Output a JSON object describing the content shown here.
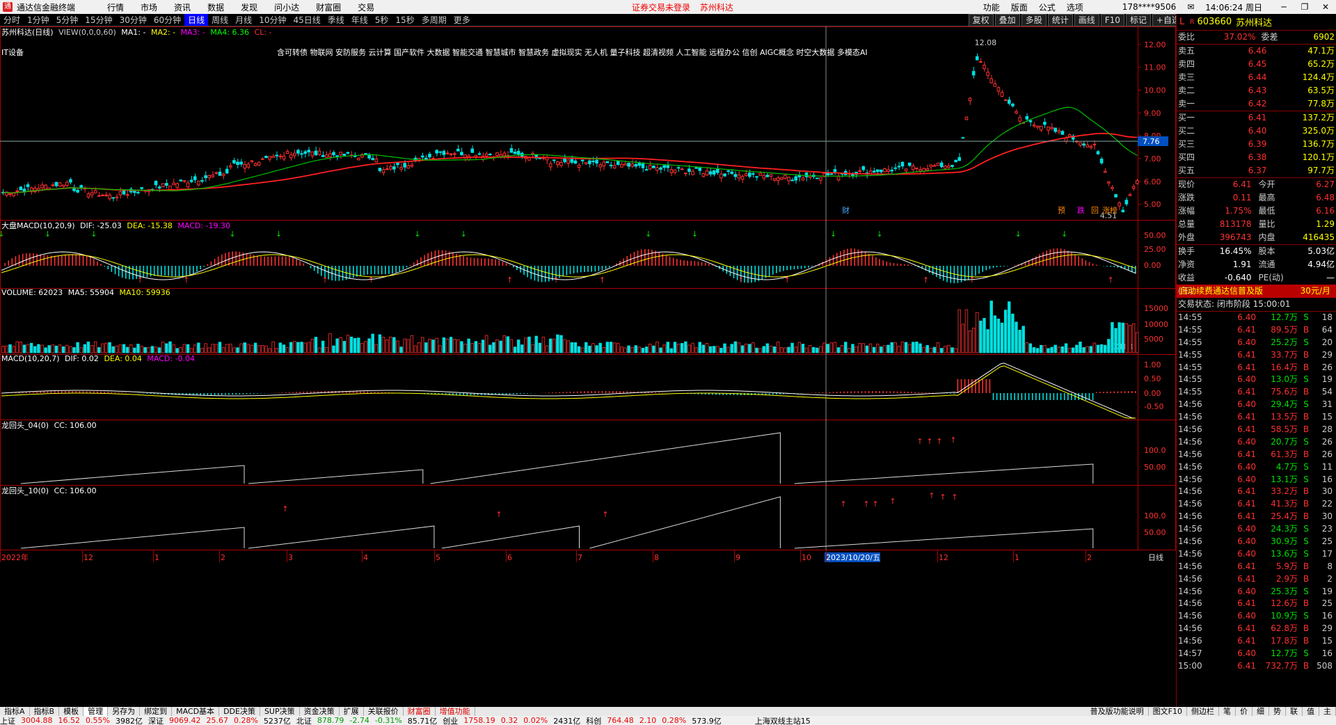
{
  "app": {
    "title": "通达信金融终端",
    "menus": [
      "行情",
      "市场",
      "资讯",
      "数据",
      "发现",
      "问小达",
      "财富圈",
      "交易"
    ],
    "center_notice": "证券交易未登录",
    "center_stock": "苏州科达",
    "right_items": [
      "功能",
      "版面",
      "公式",
      "选项"
    ],
    "account": "178****9506",
    "clock": "14:06:24 周日"
  },
  "periods": [
    "分时",
    "1分钟",
    "5分钟",
    "15分钟",
    "30分钟",
    "60分钟",
    "日线",
    "周线",
    "月线",
    "10分钟",
    "45日线",
    "季线",
    "年线",
    "5秒",
    "15秒",
    "多周期",
    "更多"
  ],
  "active_period": "日线",
  "chart_tools": [
    "复权",
    "叠加",
    "多股",
    "统计",
    "画线",
    "F10",
    "标记",
    "+自选",
    "返回"
  ],
  "main_panel": {
    "title": "苏州科达(日线)",
    "view": "VIEW(0,0,0,60)",
    "ma1": "MA1: -",
    "ma2": "MA2: -",
    "ma3": "MA3: -",
    "ma4": "MA4: 6.36",
    "cl": "CL: -",
    "sector": "IT设备",
    "concepts": "含可转债 物联网 安防服务 云计算 国产软件 大数据 智能交通 智慧城市 智慧政务 虚拟现实 无人机 量子科技 超清视频 人工智能 远程办公 信创 AIGC概念 时空大数据 多模态AI",
    "high_label": "12.08",
    "low_label": "4.51",
    "price_line_label": "7.76",
    "axis_ticks": [
      "12.00",
      "11.00",
      "10.00",
      "9.00",
      "8.00",
      "7.00",
      "6.00",
      "5.00"
    ],
    "marker_cai": "财",
    "marker_yu": "预",
    "marker_die": "跌",
    "marker_huiji": "回",
    "marker_zhang": "涨榜"
  },
  "macd_market": {
    "title": "大盘MACD(10,20,9)",
    "dif": "DIF: -25.03",
    "dea": "DEA: -15.38",
    "macd": "MACD: -19.30",
    "axis_ticks": [
      "50.00",
      "25.00",
      "0.00"
    ]
  },
  "volume": {
    "title": "VOLUME: 62023",
    "ma5": "MA5: 55904",
    "ma10": "MA10: 59936",
    "axis_ticks": [
      "15000",
      "10000",
      "5000"
    ],
    "unit": "X100"
  },
  "macd": {
    "title": "MACD(10,20,7)",
    "dif": "DIF: 0.02",
    "dea": "DEA: 0.04",
    "macd": "MACD: -0.04",
    "axis_ticks": [
      "1.00",
      "0.50",
      "0.00",
      "-0.50"
    ]
  },
  "dragon4": {
    "title": "龙回头_04(0)",
    "cc": "CC: 106.00",
    "axis_ticks": [
      "100.0",
      "50.00"
    ]
  },
  "dragon10": {
    "title": "龙回头_10(0)",
    "cc": "CC: 106.00",
    "axis_ticks": [
      "100.0",
      "50.00"
    ]
  },
  "x_axis": {
    "labels": [
      "2022年",
      "12",
      "1",
      "2",
      "3",
      "4",
      "5",
      "6",
      "7",
      "8",
      "9",
      "10",
      "2023/10/20/五",
      "12",
      "1",
      "2"
    ],
    "period_label": "日线"
  },
  "quote": {
    "code": "603660",
    "name": "苏州科达",
    "prefix": "L",
    "r_badge": "R",
    "webi_label": "委比",
    "webi": "37.02%",
    "weicha_label": "委差",
    "weicha": "6902",
    "asks": [
      {
        "label": "卖五",
        "price": "6.46",
        "vol": "47.1万"
      },
      {
        "label": "卖四",
        "price": "6.45",
        "vol": "65.2万"
      },
      {
        "label": "卖三",
        "price": "6.44",
        "vol": "124.4万"
      },
      {
        "label": "卖二",
        "price": "6.43",
        "vol": "63.5万"
      },
      {
        "label": "卖一",
        "price": "6.42",
        "vol": "77.8万"
      }
    ],
    "bids": [
      {
        "label": "买一",
        "price": "6.41",
        "vol": "137.2万"
      },
      {
        "label": "买二",
        "price": "6.40",
        "vol": "325.0万"
      },
      {
        "label": "买三",
        "price": "6.39",
        "vol": "136.7万"
      },
      {
        "label": "买四",
        "price": "6.38",
        "vol": "120.1万"
      },
      {
        "label": "买五",
        "price": "6.37",
        "vol": "97.7万"
      }
    ],
    "stats": [
      {
        "l1": "现价",
        "v1": "6.41",
        "l2": "今开",
        "v2": "6.27"
      },
      {
        "l1": "涨跌",
        "v1": "0.11",
        "l2": "最高",
        "v2": "6.48"
      },
      {
        "l1": "涨幅",
        "v1": "1.75%",
        "l2": "最低",
        "v2": "6.16"
      },
      {
        "l1": "总量",
        "v1": "813178",
        "l2": "量比",
        "v2": "1.29"
      },
      {
        "l1": "外盘",
        "v1": "396743",
        "l2": "内盘",
        "v2": "416435"
      }
    ],
    "stats2": [
      {
        "l1": "换手",
        "v1": "16.45%",
        "l2": "股本",
        "v2": "5.03亿"
      },
      {
        "l1": "净资",
        "v1": "1.91",
        "l2": "流通",
        "v2": "4.94亿"
      },
      {
        "l1": "收益(三)",
        "v1": "-0.640",
        "l2": "PE(动)",
        "v2": "—"
      }
    ],
    "service_text": "自动续费通达信普及版",
    "service_price": "30元/月",
    "trade_status": "交易状态: 闭市阶段 15:00:01"
  },
  "trades": [
    {
      "t": "14:55",
      "p": "6.40",
      "v": "12.7万",
      "bs": "S",
      "n": "18"
    },
    {
      "t": "14:55",
      "p": "6.41",
      "v": "89.5万",
      "bs": "B",
      "n": "64"
    },
    {
      "t": "14:55",
      "p": "6.40",
      "v": "25.2万",
      "bs": "S",
      "n": "20"
    },
    {
      "t": "14:55",
      "p": "6.41",
      "v": "33.7万",
      "bs": "B",
      "n": "29"
    },
    {
      "t": "14:55",
      "p": "6.41",
      "v": "16.4万",
      "bs": "B",
      "n": "26"
    },
    {
      "t": "14:55",
      "p": "6.40",
      "v": "13.0万",
      "bs": "S",
      "n": "19"
    },
    {
      "t": "14:55",
      "p": "6.41",
      "v": "75.6万",
      "bs": "B",
      "n": "54"
    },
    {
      "t": "14:56",
      "p": "6.40",
      "v": "29.4万",
      "bs": "S",
      "n": "31"
    },
    {
      "t": "14:56",
      "p": "6.41",
      "v": "13.5万",
      "bs": "B",
      "n": "15"
    },
    {
      "t": "14:56",
      "p": "6.41",
      "v": "58.5万",
      "bs": "B",
      "n": "28"
    },
    {
      "t": "14:56",
      "p": "6.40",
      "v": "20.7万",
      "bs": "S",
      "n": "26"
    },
    {
      "t": "14:56",
      "p": "6.41",
      "v": "61.3万",
      "bs": "B",
      "n": "26"
    },
    {
      "t": "14:56",
      "p": "6.40",
      "v": "4.7万",
      "bs": "S",
      "n": "11"
    },
    {
      "t": "14:56",
      "p": "6.40",
      "v": "13.1万",
      "bs": "S",
      "n": "16"
    },
    {
      "t": "14:56",
      "p": "6.41",
      "v": "33.2万",
      "bs": "B",
      "n": "30"
    },
    {
      "t": "14:56",
      "p": "6.41",
      "v": "41.3万",
      "bs": "B",
      "n": "22"
    },
    {
      "t": "14:56",
      "p": "6.41",
      "v": "25.4万",
      "bs": "B",
      "n": "30"
    },
    {
      "t": "14:56",
      "p": "6.40",
      "v": "24.3万",
      "bs": "S",
      "n": "23"
    },
    {
      "t": "14:56",
      "p": "6.40",
      "v": "30.9万",
      "bs": "S",
      "n": "25"
    },
    {
      "t": "14:56",
      "p": "6.40",
      "v": "13.6万",
      "bs": "S",
      "n": "17"
    },
    {
      "t": "14:56",
      "p": "6.41",
      "v": "5.9万",
      "bs": "B",
      "n": "8"
    },
    {
      "t": "14:56",
      "p": "6.41",
      "v": "2.9万",
      "bs": "B",
      "n": "2"
    },
    {
      "t": "14:56",
      "p": "6.40",
      "v": "25.3万",
      "bs": "S",
      "n": "19"
    },
    {
      "t": "14:56",
      "p": "6.41",
      "v": "12.6万",
      "bs": "B",
      "n": "25"
    },
    {
      "t": "14:56",
      "p": "6.40",
      "v": "10.9万",
      "bs": "S",
      "n": "16"
    },
    {
      "t": "14:56",
      "p": "6.41",
      "v": "62.8万",
      "bs": "B",
      "n": "29"
    },
    {
      "t": "14:56",
      "p": "6.41",
      "v": "17.8万",
      "bs": "B",
      "n": "15"
    },
    {
      "t": "14:57",
      "p": "6.40",
      "v": "12.7万",
      "bs": "S",
      "n": "16"
    },
    {
      "t": "15:00",
      "p": "6.41",
      "v": "732.7万",
      "bs": "B",
      "n": "508"
    }
  ],
  "bottom_tabs": [
    "指标A",
    "指标B",
    "模板",
    "管理",
    "另存为",
    "绑定到",
    "MACD基本",
    "DDE决策",
    "SUP决策",
    "资金决策"
  ],
  "active_tab": "管理",
  "bottom_tabs2": [
    "扩展",
    "关联报价",
    "财富圈",
    "增值功能"
  ],
  "bottom_right": [
    "普及版功能说明",
    "图文F10",
    "侧边栏"
  ],
  "bottom_right_icons": [
    "笔",
    "价",
    "细",
    "势",
    "联",
    "值",
    "主"
  ],
  "status": {
    "sh_label": "上证",
    "sh": "3004.88",
    "sh_chg": "16.52",
    "sh_pct": "0.55%",
    "sh_amt": "3982亿",
    "sz_label": "深证",
    "sz": "9069.42",
    "sz_chg": "25.67",
    "sz_pct": "0.28%",
    "sz_amt": "5237亿",
    "bz_label": "北证",
    "bz": "878.79",
    "bz_chg": "-2.74",
    "bz_pct": "-0.31%",
    "bz_amt": "85.71亿",
    "cy_label": "创业",
    "cy": "1758.19",
    "cy_chg": "0.32",
    "cy_pct": "0.02%",
    "cy_amt": "2431亿",
    "kc_label": "科创",
    "kc": "764.48",
    "kc_chg": "2.10",
    "kc_pct": "0.28%",
    "kc_amt": "573.9亿",
    "server": "上海双线主站15"
  },
  "chart_data": {
    "type": "line",
    "series": [
      {
        "name": "MA4",
        "values": [
          6.36
        ]
      }
    ],
    "ylim": [
      4.5,
      12.3
    ]
  }
}
